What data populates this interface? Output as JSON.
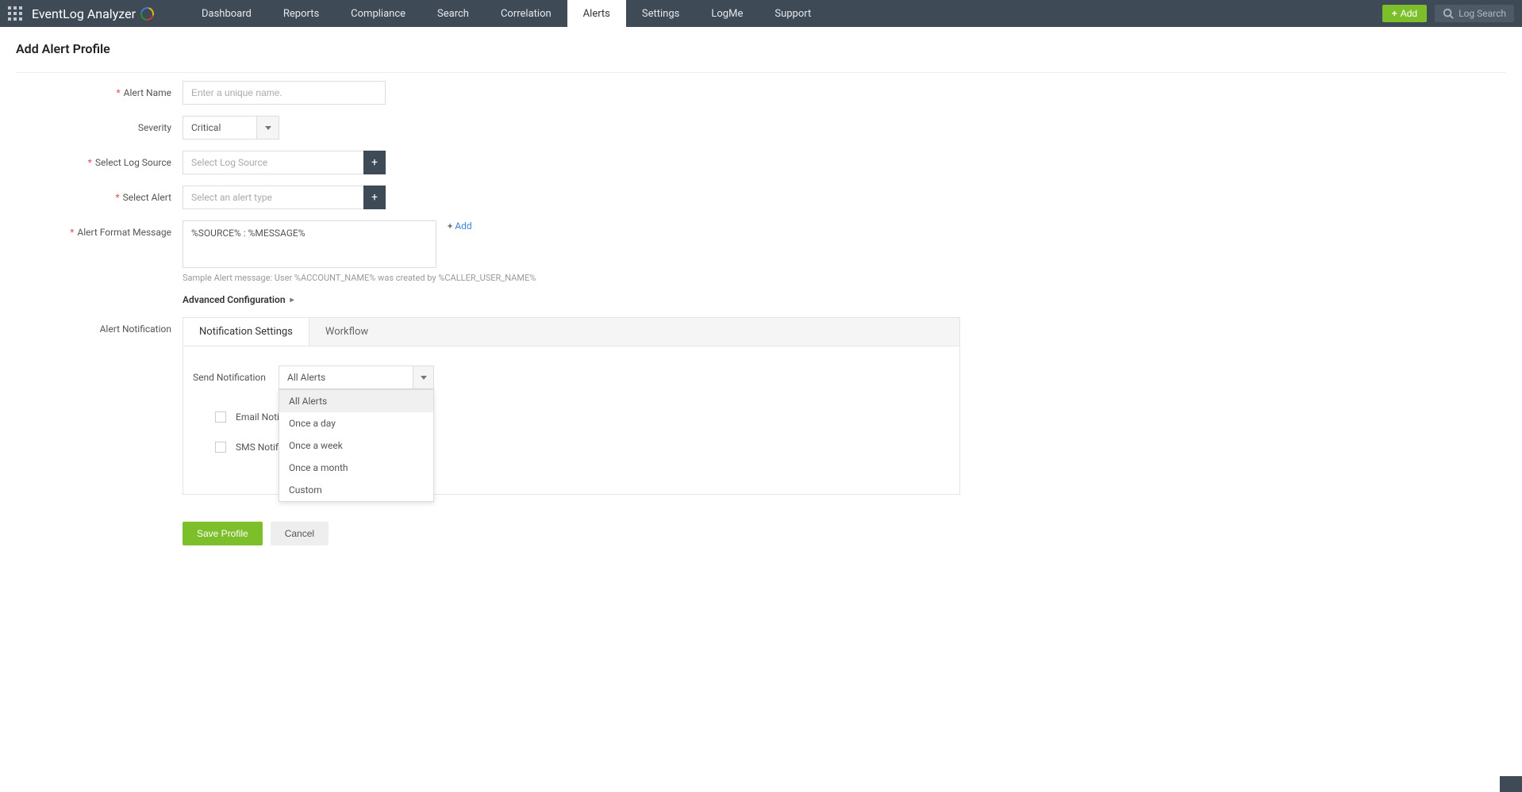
{
  "brand": {
    "name_part1": "EventLog",
    "name_part2": " Analyzer"
  },
  "nav": {
    "items": [
      {
        "label": "Dashboard"
      },
      {
        "label": "Reports"
      },
      {
        "label": "Compliance"
      },
      {
        "label": "Search"
      },
      {
        "label": "Correlation"
      },
      {
        "label": "Alerts",
        "active": true
      },
      {
        "label": "Settings"
      },
      {
        "label": "LogMe"
      },
      {
        "label": "Support"
      }
    ]
  },
  "topbar_right": {
    "add_button": "Add",
    "log_search_placeholder": "Log Search"
  },
  "page": {
    "title": "Add Alert Profile"
  },
  "form": {
    "alert_name": {
      "label": "Alert Name",
      "placeholder": "Enter a unique name."
    },
    "severity": {
      "label": "Severity",
      "value": "Critical"
    },
    "log_source": {
      "label": "Select Log Source",
      "placeholder": "Select Log Source"
    },
    "select_alert": {
      "label": "Select Alert",
      "placeholder": "Select an alert type"
    },
    "format_message": {
      "label": "Alert Format Message",
      "value": "%SOURCE% : %MESSAGE%",
      "add_link": "Add",
      "sample": "Sample Alert message: User %ACCOUNT_NAME% was created by %CALLER_USER_NAME%"
    },
    "advanced_config": "Advanced Configuration",
    "alert_notification_label": "Alert Notification"
  },
  "tabs": {
    "notification_settings": "Notification Settings",
    "workflow": "Workflow"
  },
  "notification_panel": {
    "send_notification_label": "Send Notification",
    "selected": "All Alerts",
    "options": [
      "All Alerts",
      "Once a day",
      "Once a week",
      "Once a month",
      "Custom"
    ],
    "email_notification": "Email Noti",
    "sms_notification": "SMS Notifi"
  },
  "actions": {
    "save": "Save Profile",
    "cancel": "Cancel"
  }
}
